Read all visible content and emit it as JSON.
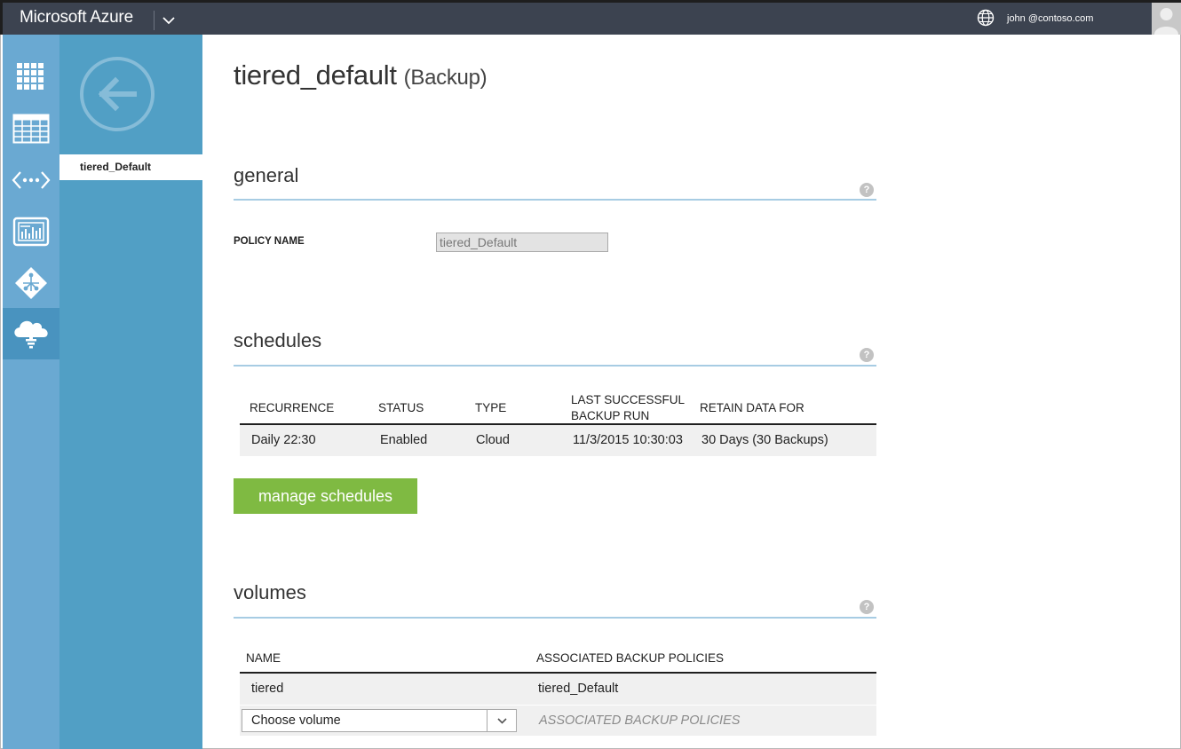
{
  "topbar": {
    "brand": "Microsoft Azure",
    "user_email": "john @contoso.com"
  },
  "icon_nav": {
    "items": [
      {
        "icon": "grid-icon"
      },
      {
        "icon": "table-icon"
      },
      {
        "icon": "code-dots-icon"
      },
      {
        "icon": "dashboard-icon"
      },
      {
        "icon": "network-diamond-icon"
      },
      {
        "icon": "cloud-storage-icon",
        "active": true
      }
    ]
  },
  "subnav": {
    "selected_item": "tiered_Default"
  },
  "page": {
    "title": "tiered_default",
    "subtitle": "(Backup)"
  },
  "general": {
    "title": "general",
    "help": "?",
    "policy_name_label": "POLICY NAME",
    "policy_name_value": "tiered_Default"
  },
  "schedules": {
    "title": "schedules",
    "help": "?",
    "columns": [
      "RECURRENCE",
      "STATUS",
      "TYPE",
      "LAST SUCCESSFUL BACKUP RUN",
      "RETAIN DATA FOR"
    ],
    "rows": [
      {
        "recurrence": "Daily 22:30",
        "status": "Enabled",
        "type": "Cloud",
        "last_run": "11/3/2015 10:30:03",
        "retain": "30 Days (30 Backups)"
      }
    ],
    "manage_button": "manage schedules"
  },
  "volumes": {
    "title": "volumes",
    "help": "?",
    "columns": [
      "NAME",
      "ASSOCIATED BACKUP POLICIES"
    ],
    "rows": [
      {
        "name": "tiered",
        "policies": "tiered_Default"
      }
    ],
    "choose_volume": "Choose volume",
    "policies_placeholder": "ASSOCIATED BACKUP POLICIES"
  },
  "colors": {
    "topbar": "#3c4350",
    "iconnav": "#6aa9d2",
    "subnav": "#519fc5",
    "accent_green": "#7fba42",
    "section_line": "#a7cce3"
  }
}
